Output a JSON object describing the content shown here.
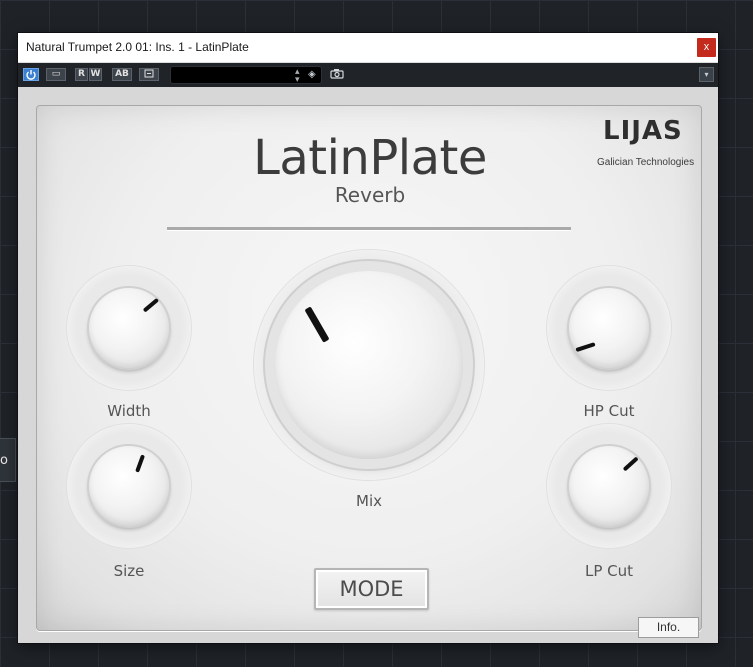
{
  "window": {
    "title": "Natural Trumpet 2.0 01: Ins. 1 - LatinPlate",
    "close_label": "x"
  },
  "toolbar": {
    "compare_label": "▭",
    "read_label": "R",
    "write_label": "W",
    "ab_label": "AB",
    "preset_field_value": "",
    "menu_label": "▾",
    "icons": [
      "power-icon",
      "compare-icon",
      "copy-icon",
      "preset-arrows-icon",
      "tag-icon",
      "camera-icon",
      "chevron-down-icon"
    ]
  },
  "plugin": {
    "name": "LatinPlate",
    "subtitle": "Reverb",
    "logo": {
      "mark": "LIJAS",
      "maker": "Galician Technologies"
    },
    "knobs": {
      "width": {
        "label": "Width"
      },
      "size": {
        "label": "Size"
      },
      "mix": {
        "label": "Mix"
      },
      "hp_cut": {
        "label": "HP Cut"
      },
      "lp_cut": {
        "label": "LP Cut"
      }
    },
    "mode_label": "MODE",
    "info_label": "Info."
  },
  "background": {
    "stub_label": "o"
  },
  "colors": {
    "accent_power": "#3b7fd0",
    "close": "#c42b1c",
    "daw_background": "#1f2328"
  }
}
